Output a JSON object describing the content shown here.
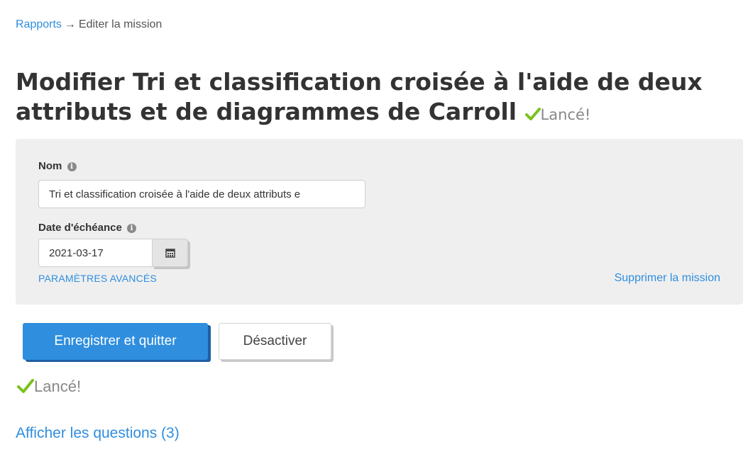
{
  "breadcrumb": {
    "link": "Rapports",
    "separator": "→",
    "current": "Editer la mission"
  },
  "header": {
    "title": "Modifier Tri et classification croisée à l'aide de deux attributs et de diagrammes de Carroll",
    "status": "Lancé!"
  },
  "form": {
    "name_label": "Nom",
    "name_value": "Tri et classification croisée à l'aide de deux attributs e",
    "date_label": "Date d'échéance",
    "date_value": "2021-03-17",
    "advanced_link": "PARAMÈTRES AVANCÉS",
    "delete_link": "Supprimer la mission"
  },
  "actions": {
    "save_label": "Enregistrer et quitter",
    "deactivate_label": "Désactiver"
  },
  "status": {
    "text": "Lancé!"
  },
  "questions_link": "Afficher les questions (3)",
  "icons": {
    "info": "info-icon",
    "calendar": "calendar-icon",
    "check": "check-icon"
  },
  "colors": {
    "link": "#2f8ede",
    "primary": "#2f8ede",
    "check": "#79c21c",
    "panel": "#efefef"
  }
}
